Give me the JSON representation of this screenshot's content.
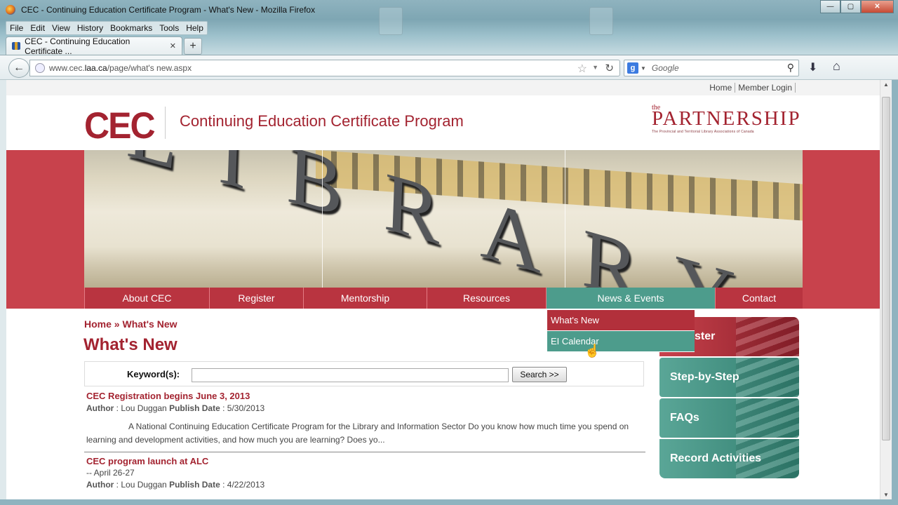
{
  "window": {
    "title": "CEC - Continuing Education Certificate Program - What's New - Mozilla Firefox",
    "buttons": {
      "min": "—",
      "max": "▢",
      "close": "✕"
    }
  },
  "menubar": [
    "File",
    "Edit",
    "View",
    "History",
    "Bookmarks",
    "Tools",
    "Help"
  ],
  "tab": {
    "label": "CEC - Continuing Education Certificate ...",
    "close": "✕",
    "new": "+"
  },
  "url": {
    "prefix": "www.cec.",
    "domain": "laa.ca",
    "path": "/page/what's new.aspx"
  },
  "search": {
    "engine": "g",
    "placeholder": "Google"
  },
  "site": {
    "toplinks": [
      "Home",
      "Member Login"
    ],
    "logo": "CEC",
    "program": "Continuing Education Certificate Program",
    "partnership": {
      "the": "the",
      "name": "PARTNERSHIP",
      "sub": "The Provincial and Territorial Library Associations of Canada"
    },
    "banner_text": "LIBRARY",
    "nav": [
      {
        "label": "About CEC"
      },
      {
        "label": "Register"
      },
      {
        "label": "Mentorship"
      },
      {
        "label": "Resources"
      },
      {
        "label": "News & Events",
        "active": true
      },
      {
        "label": "Contact"
      }
    ],
    "dropdown": [
      "What's New",
      "EI Calendar"
    ],
    "breadcrumb": {
      "home": "Home",
      "sep": "»",
      "current": "What's New"
    },
    "heading": "What's New",
    "search_form": {
      "label": "Keyword(s):",
      "button": "Search >>"
    },
    "news": [
      {
        "title": "CEC Registration begins June 3, 2013",
        "author_label": "Author",
        "author": "Lou Duggan",
        "date_label": "Publish Date",
        "date": "5/30/2013",
        "body": "A National Continuing Education Certificate Program for the Library and Information Sector   Do you know how much time you spend on learning and development activities, and how much you are learning? Does yo..."
      },
      {
        "title": "CEC program launch at ALC",
        "subtitle": "-- April 26-27",
        "author_label": "Author",
        "author": "Lou Duggan",
        "date_label": "Publish Date",
        "date": "4/22/2013"
      }
    ],
    "sidebar": [
      "ster",
      "Step-by-Step",
      "FAQs",
      "Record Activities"
    ]
  },
  "colors": {
    "brand": "#a32330",
    "nav": "#c8424c",
    "teal": "#4d9c8c"
  }
}
